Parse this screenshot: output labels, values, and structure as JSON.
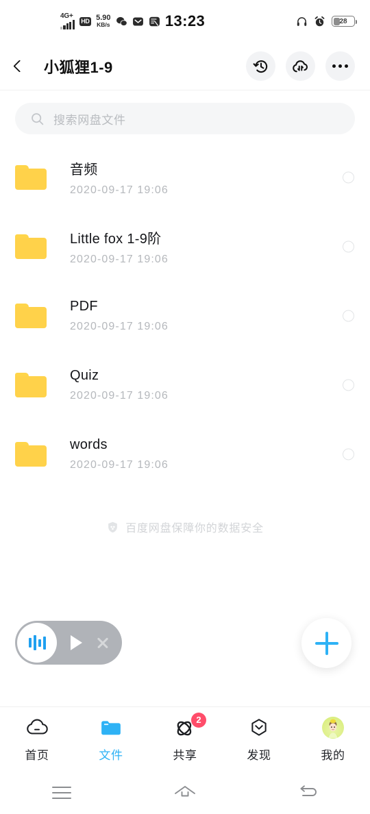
{
  "statusbar": {
    "network_type": "4G+",
    "hd_label": "HD",
    "speed_value": "5.90",
    "speed_unit": "KB/s",
    "time": "13:23",
    "battery_percent": "28",
    "icons": [
      "signal-icon",
      "hd-icon",
      "wechat-icon",
      "mail-icon",
      "alipay-icon",
      "headphone-icon",
      "alarm-icon",
      "battery-icon"
    ]
  },
  "header": {
    "back_icon": "back-chevron-icon",
    "title": "小狐狸1-9",
    "actions": [
      {
        "name": "history-icon"
      },
      {
        "name": "transfer-cloud-icon"
      },
      {
        "name": "more-icon"
      }
    ]
  },
  "search": {
    "placeholder": "搜索网盘文件",
    "value": "",
    "icon": "search-icon"
  },
  "files": [
    {
      "name": "音频",
      "date": "2020-09-17  19:06",
      "icon": "folder-icon",
      "selected": false
    },
    {
      "name": "Little fox 1-9阶",
      "date": "2020-09-17  19:06",
      "icon": "folder-icon",
      "selected": false
    },
    {
      "name": "PDF",
      "date": "2020-09-17  19:06",
      "icon": "folder-icon",
      "selected": false
    },
    {
      "name": "Quiz",
      "date": "2020-09-17  19:06",
      "icon": "folder-icon",
      "selected": false
    },
    {
      "name": "words",
      "date": "2020-09-17  19:06",
      "icon": "folder-icon",
      "selected": false
    }
  ],
  "safety_note": {
    "icon": "shield-icon",
    "text": "百度网盘保障你的数据安全"
  },
  "player": {
    "waveform_icon": "audio-waveform-icon",
    "play_icon": "play-icon",
    "close_icon": "close-icon"
  },
  "fab": {
    "icon": "plus-icon",
    "color": "#2eb2f5"
  },
  "bottom_nav": {
    "active_index": 1,
    "accent_color": "#2eb2f5",
    "badge_color": "#ff4d6a",
    "items": [
      {
        "label": "首页",
        "icon": "cloud-icon",
        "badge": ""
      },
      {
        "label": "文件",
        "icon": "folder-icon",
        "badge": ""
      },
      {
        "label": "共享",
        "icon": "share-atom-icon",
        "badge": "2"
      },
      {
        "label": "发现",
        "icon": "discover-hexagon-icon",
        "badge": ""
      },
      {
        "label": "我的",
        "icon": "avatar-icon",
        "badge": ""
      }
    ]
  },
  "android_nav": {
    "items": [
      {
        "name": "recents-icon"
      },
      {
        "name": "home-icon"
      },
      {
        "name": "back-icon"
      }
    ]
  }
}
